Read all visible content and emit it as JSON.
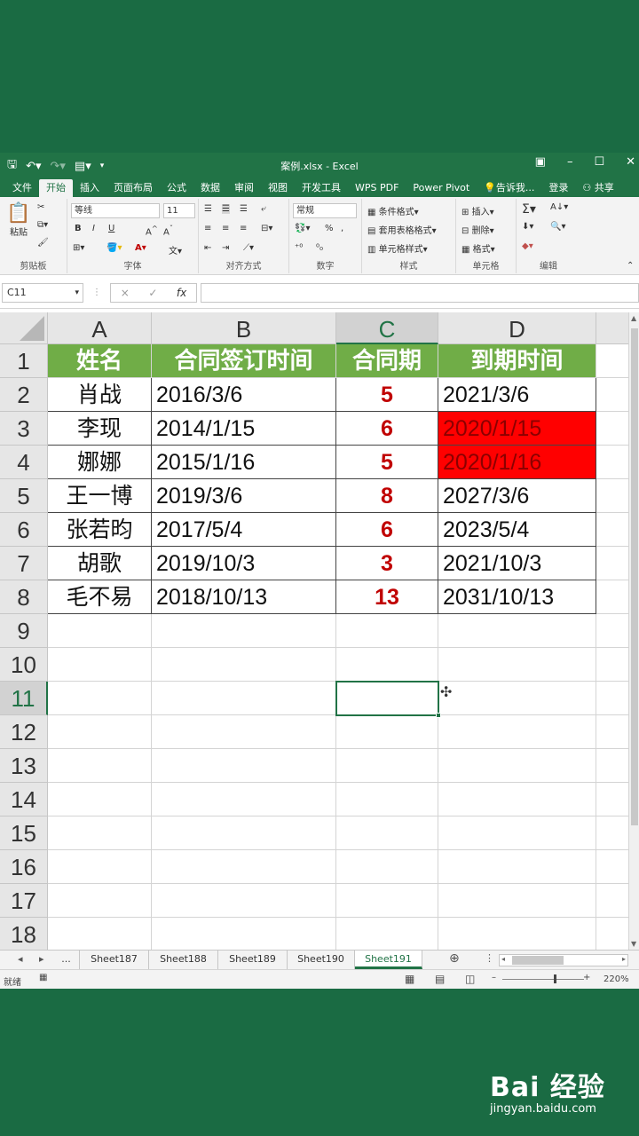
{
  "window": {
    "title": "案例.xlsx - Excel",
    "controls": [
      "restore-ribbon-icon",
      "minimize-icon",
      "maximize-icon",
      "close-icon"
    ]
  },
  "qat": [
    "save-icon",
    "undo-icon",
    "redo-icon",
    "form-icon"
  ],
  "tabs": [
    {
      "label": "文件"
    },
    {
      "label": "开始"
    },
    {
      "label": "插入"
    },
    {
      "label": "页面布局"
    },
    {
      "label": "公式"
    },
    {
      "label": "数据"
    },
    {
      "label": "审阅"
    },
    {
      "label": "视图"
    },
    {
      "label": "开发工具"
    },
    {
      "label": "WPS PDF"
    },
    {
      "label": "Power Pivot"
    },
    {
      "label": "告诉我..."
    },
    {
      "label": "登录"
    },
    {
      "label": "共享"
    }
  ],
  "ribbon": {
    "clipboard": {
      "label": "剪贴板",
      "paste": "粘贴"
    },
    "font": {
      "label": "字体",
      "name": "等线",
      "size": "11",
      "bold": "B",
      "italic": "I",
      "underline": "U"
    },
    "alignment": {
      "label": "对齐方式"
    },
    "number": {
      "label": "数字",
      "format": "常规",
      "percent": "%",
      "comma": ","
    },
    "styles": {
      "label": "样式",
      "cond": "条件格式",
      "table": "套用表格格式",
      "cell": "单元格样式"
    },
    "cells": {
      "label": "单元格",
      "insert": "插入",
      "delete": "删除",
      "format": "格式"
    },
    "editing": {
      "label": "编辑"
    }
  },
  "formula_bar": {
    "name_box": "C11",
    "cancel": "×",
    "enter": "✓",
    "fx": "fx",
    "value": ""
  },
  "columns": [
    "A",
    "B",
    "C",
    "D"
  ],
  "rows": [
    "1",
    "2",
    "3",
    "4",
    "5",
    "6",
    "7",
    "8",
    "9",
    "10",
    "11",
    "12",
    "13",
    "14",
    "15",
    "16",
    "17",
    "18"
  ],
  "table": {
    "headers": [
      "姓名",
      "合同签订时间",
      "合同期",
      "到期时间"
    ],
    "records": [
      {
        "name": "肖战",
        "signed": "2016/3/6",
        "term": "5",
        "expiry": "2021/3/6",
        "expired": false
      },
      {
        "name": "李现",
        "signed": "2014/1/15",
        "term": "6",
        "expiry": "2020/1/15",
        "expired": true
      },
      {
        "name": "娜娜",
        "signed": "2015/1/16",
        "term": "5",
        "expiry": "2020/1/16",
        "expired": true
      },
      {
        "name": "王一博",
        "signed": "2019/3/6",
        "term": "8",
        "expiry": "2027/3/6",
        "expired": false
      },
      {
        "name": "张若昀",
        "signed": "2017/5/4",
        "term": "6",
        "expiry": "2023/5/4",
        "expired": false
      },
      {
        "name": "胡歌",
        "signed": "2019/10/3",
        "term": "3",
        "expiry": "2021/10/3",
        "expired": false
      },
      {
        "name": "毛不易",
        "signed": "2018/10/13",
        "term": "13",
        "expiry": "2031/10/13",
        "expired": false
      }
    ]
  },
  "colors": {
    "header_fill": "#70ad47",
    "expired_fill": "#ff0000",
    "term_text": "#c00000",
    "excel_green": "#217346"
  },
  "sheets": {
    "more": "...",
    "tabs": [
      "Sheet187",
      "Sheet188",
      "Sheet189",
      "Sheet190",
      "Sheet191"
    ],
    "active": "Sheet191"
  },
  "status": {
    "ready": "就绪",
    "zoom": "220%"
  },
  "watermark": {
    "brand": "Bai 经验",
    "url": "jingyan.baidu.com"
  }
}
